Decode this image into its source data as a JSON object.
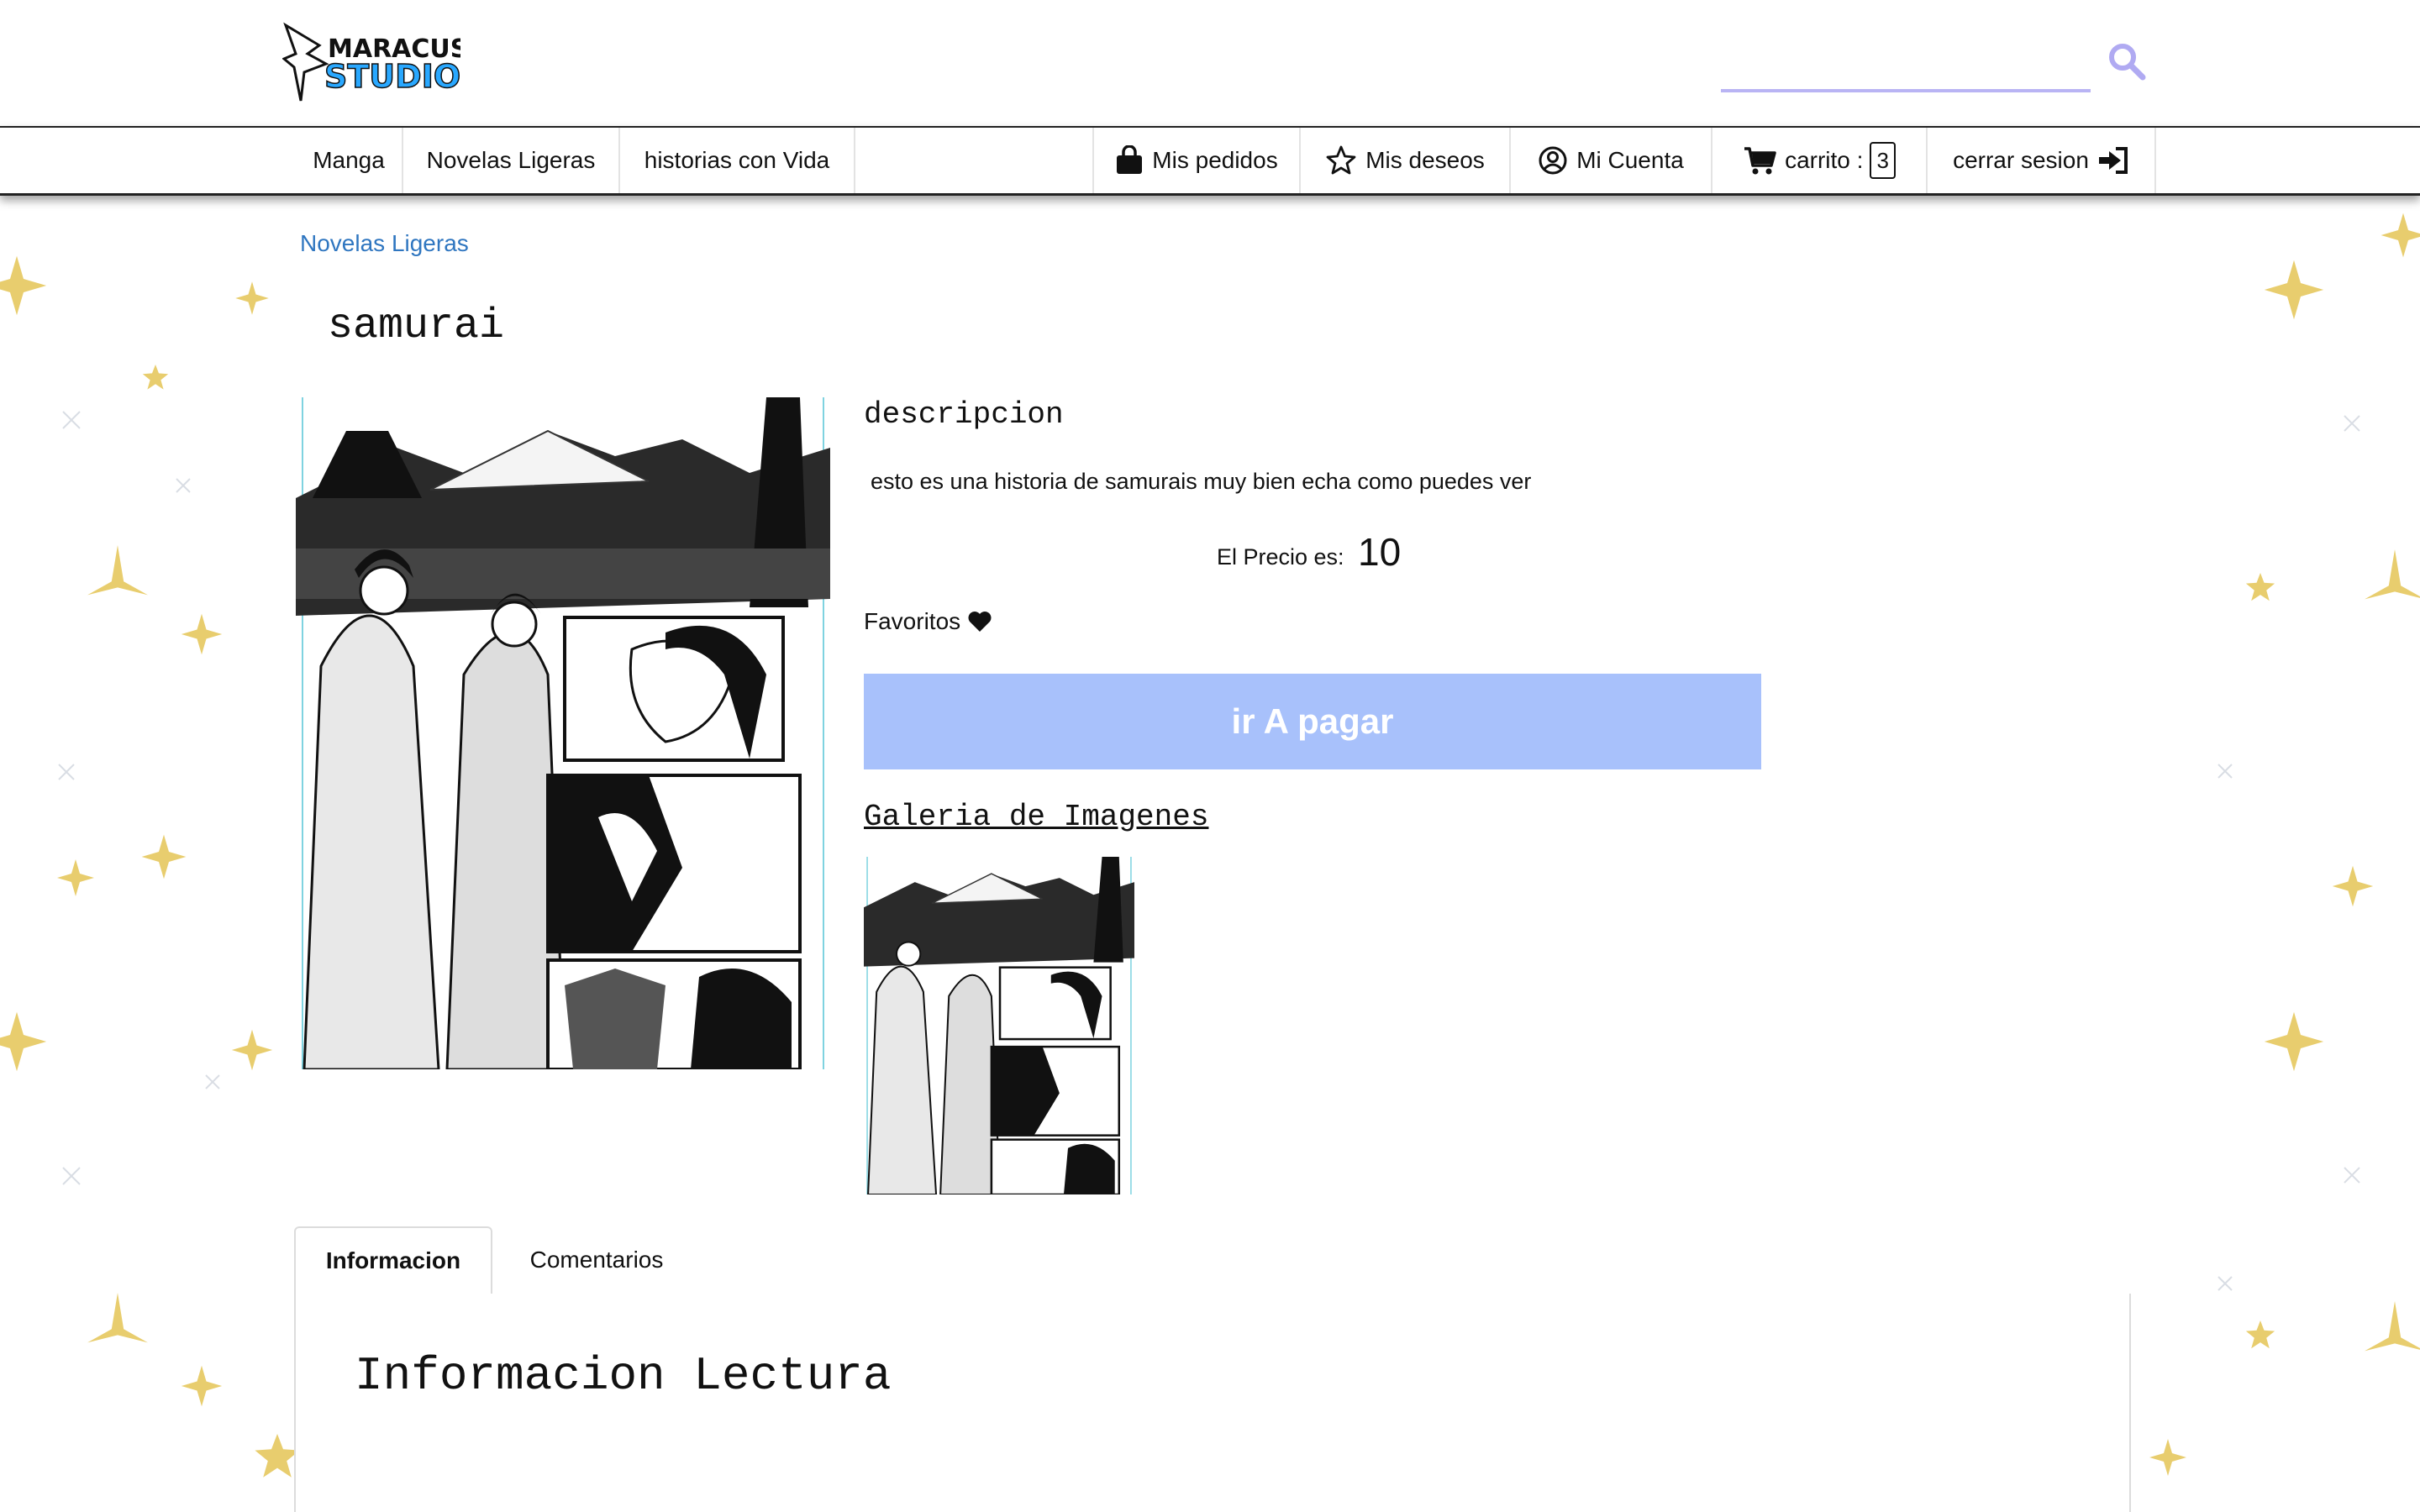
{
  "header": {
    "logo_text_top": "MARACUS",
    "logo_text_bottom": "STUDIO",
    "search_value": ""
  },
  "nav": {
    "left": [
      {
        "label": "Manga"
      },
      {
        "label": "Novelas Ligeras"
      },
      {
        "label": "historias con Vida"
      }
    ],
    "orders": "Mis pedidos",
    "wishlist": "Mis deseos",
    "account": "Mi Cuenta",
    "cart_label": "carrito :",
    "cart_count": "3",
    "logout": "cerrar sesion"
  },
  "product": {
    "breadcrumb": "Novelas Ligeras",
    "title": "samurai",
    "description_heading": "descripcion",
    "description": "esto es una historia de samurais muy bien echa como puedes ver",
    "price_label": "El Precio es:",
    "price_value": "10",
    "favorites_label": "Favoritos",
    "pay_button": "ir A pagar",
    "gallery_heading": "Galeria de Imagenes"
  },
  "tabs": [
    {
      "label": "Informacion",
      "active": true
    },
    {
      "label": "Comentarios",
      "active": false
    }
  ],
  "panel": {
    "heading": "Informacion Lectura"
  },
  "colors": {
    "accent_blue": "#2f76c0",
    "pay_button": "#a8c1fb",
    "search_underline": "#b9b4f4",
    "logo_blue": "#29a8ff",
    "star_gold": "#e3c25a"
  }
}
